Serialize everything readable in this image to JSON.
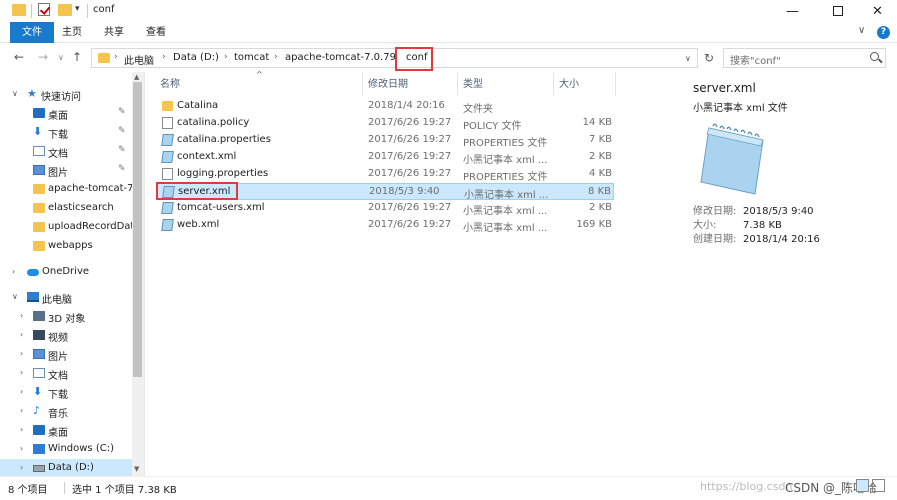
{
  "window": {
    "title": "conf",
    "quick_access_pin": "▾",
    "minimize": "—",
    "close": "✕"
  },
  "ribbon": {
    "tabs": [
      "文件",
      "主页",
      "共享",
      "查看"
    ],
    "expand_chevron": "∨",
    "help": "?"
  },
  "address_bar": {
    "breadcrumbs": [
      "此电脑",
      "Data (D:)",
      "tomcat",
      "apache-tomcat-7.0.79",
      "conf"
    ],
    "separator": "›",
    "search_placeholder": "搜索\"conf\""
  },
  "nav_pane": {
    "quick_access": "快速访问",
    "pinned": [
      {
        "label": "桌面",
        "icon": "desktop-icon"
      },
      {
        "label": "下载",
        "icon": "download-icon"
      },
      {
        "label": "文档",
        "icon": "documents-icon"
      },
      {
        "label": "图片",
        "icon": "pictures-icon"
      }
    ],
    "recent": [
      "apache-tomcat-7.",
      "elasticsearch",
      "uploadRecordDat",
      "webapps"
    ],
    "onedrive": "OneDrive",
    "this_pc": "此电脑",
    "pc_items": [
      {
        "label": "3D 对象",
        "icon": "3d-objects-icon"
      },
      {
        "label": "视频",
        "icon": "videos-icon"
      },
      {
        "label": "图片",
        "icon": "pictures-icon"
      },
      {
        "label": "文档",
        "icon": "documents-icon"
      },
      {
        "label": "下载",
        "icon": "download-icon"
      },
      {
        "label": "音乐",
        "icon": "music-icon"
      },
      {
        "label": "桌面",
        "icon": "desktop-icon"
      },
      {
        "label": "Windows (C:)",
        "icon": "drive-icon"
      },
      {
        "label": "Data (D:)",
        "icon": "drive-icon"
      }
    ]
  },
  "file_list": {
    "columns": [
      "名称",
      "修改日期",
      "类型",
      "大小"
    ],
    "rows": [
      {
        "name": "Catalina",
        "date": "2018/1/4 20:16",
        "type": "文件夹",
        "size": "",
        "icon": "folder"
      },
      {
        "name": "catalina.policy",
        "date": "2017/6/26 19:27",
        "type": "POLICY 文件",
        "size": "14 KB",
        "icon": "file"
      },
      {
        "name": "catalina.properties",
        "date": "2017/6/26 19:27",
        "type": "PROPERTIES 文件",
        "size": "7 KB",
        "icon": "note"
      },
      {
        "name": "context.xml",
        "date": "2017/6/26 19:27",
        "type": "小黑记事本 xml ...",
        "size": "2 KB",
        "icon": "note"
      },
      {
        "name": "logging.properties",
        "date": "2017/6/26 19:27",
        "type": "PROPERTIES 文件",
        "size": "4 KB",
        "icon": "file"
      },
      {
        "name": "server.xml",
        "date": "2018/5/3 9:40",
        "type": "小黑记事本 xml ...",
        "size": "8 KB",
        "icon": "note",
        "selected": true
      },
      {
        "name": "tomcat-users.xml",
        "date": "2017/6/26 19:27",
        "type": "小黑记事本 xml ...",
        "size": "2 KB",
        "icon": "note"
      },
      {
        "name": "web.xml",
        "date": "2017/6/26 19:27",
        "type": "小黑记事本 xml ...",
        "size": "169 KB",
        "icon": "note"
      }
    ]
  },
  "preview": {
    "name": "server.xml",
    "type": "小黑记事本 xml 文件",
    "modified_label": "修改日期:",
    "modified": "2018/5/3 9:40",
    "size_label": "大小:",
    "size": "7.38 KB",
    "created_label": "创建日期:",
    "created": "2018/1/4 20:16"
  },
  "status_bar": {
    "count": "8 个项目",
    "selection": "选中 1 个项目  7.38 KB",
    "watermark": "https://blog.csdn",
    "credit": "CSDN @_陈哈哈"
  },
  "colors": {
    "accent": "#1979ca",
    "selection": "#cce8ff",
    "highlight": "#e03a3a",
    "folder": "#f4c451"
  }
}
